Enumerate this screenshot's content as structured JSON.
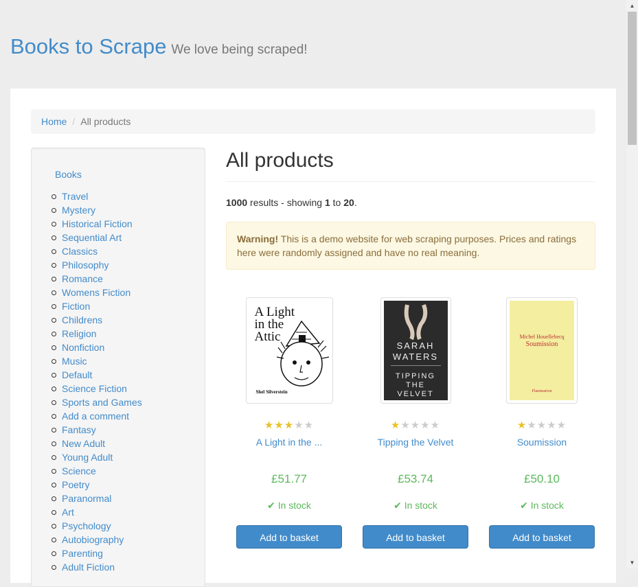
{
  "header": {
    "brand": "Books to Scrape",
    "tagline": "We love being scraped!"
  },
  "breadcrumb": {
    "home": "Home",
    "separator": "/",
    "current": "All products"
  },
  "sidebar": {
    "top_link": "Books",
    "categories": [
      "Travel",
      "Mystery",
      "Historical Fiction",
      "Sequential Art",
      "Classics",
      "Philosophy",
      "Romance",
      "Womens Fiction",
      "Fiction",
      "Childrens",
      "Religion",
      "Nonfiction",
      "Music",
      "Default",
      "Science Fiction",
      "Sports and Games",
      "Add a comment",
      "Fantasy",
      "New Adult",
      "Young Adult",
      "Science",
      "Poetry",
      "Paranormal",
      "Art",
      "Psychology",
      "Autobiography",
      "Parenting",
      "Adult Fiction"
    ]
  },
  "main": {
    "title": "All products",
    "results": {
      "total": "1000",
      "text1": " results - showing ",
      "from": "1",
      "text2": " to ",
      "to": "20",
      "text3": "."
    },
    "alert": {
      "strong": "Warning!",
      "text": " This is a demo website for web scraping purposes. Prices and ratings here were randomly assigned and have no real meaning."
    }
  },
  "products": [
    {
      "title": "A Light in the ...",
      "price": "£51.77",
      "rating": 3,
      "stock": "In stock",
      "button": "Add to basket",
      "cover": {
        "lines": [
          "A Light",
          "in the",
          "Attic"
        ],
        "byline": "Shel Silverstein"
      }
    },
    {
      "title": "Tipping the Velvet",
      "price": "£53.74",
      "rating": 1,
      "stock": "In stock",
      "button": "Add to basket",
      "cover": {
        "author": "SARAH WATERS",
        "book": "TIPPING THE VELVET"
      }
    },
    {
      "title": "Soumission",
      "price": "£50.10",
      "rating": 1,
      "stock": "In stock",
      "button": "Add to basket",
      "cover": {
        "author": "Michel Houellebecq",
        "book": "Soumission",
        "publisher": "Flammarion"
      }
    }
  ],
  "colors": {
    "link": "#428bca",
    "price": "#5cb85c",
    "star_on": "#e6c229",
    "star_off": "#cccccc",
    "alert_bg": "#fcf8e3"
  }
}
